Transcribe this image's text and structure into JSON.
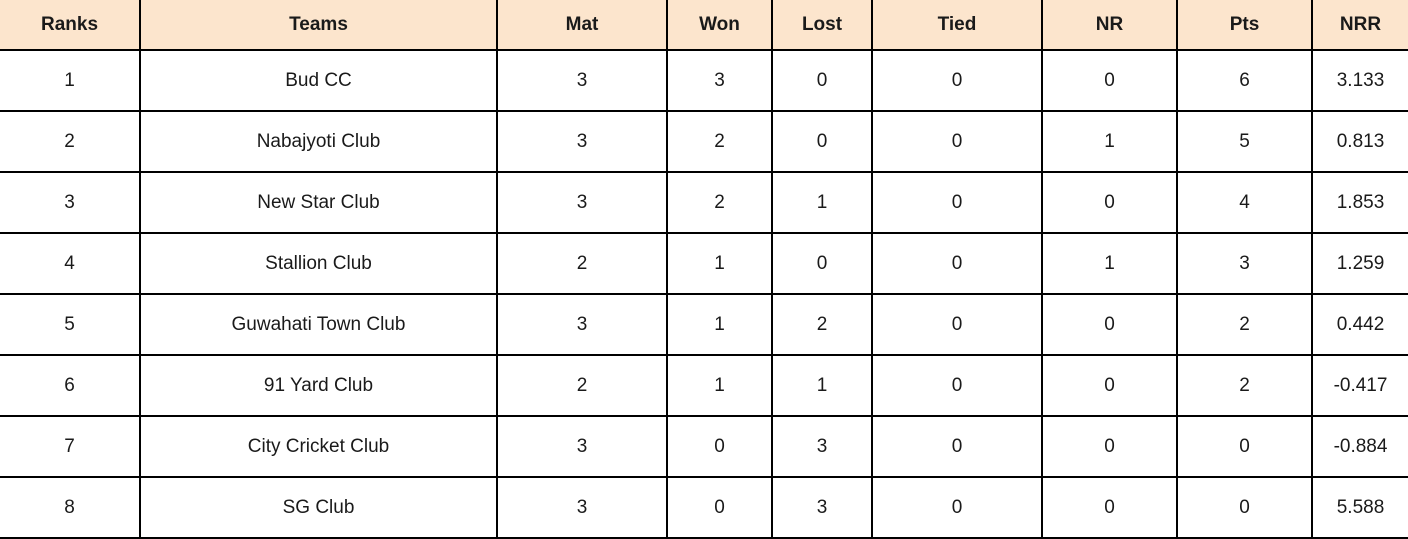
{
  "table": {
    "name": "points-table",
    "header_bg": "#fce5cd",
    "border_color": "#000000",
    "text_color": "#1a1a1a",
    "columns": [
      {
        "key": "rank",
        "label": "Ranks"
      },
      {
        "key": "team",
        "label": "Teams"
      },
      {
        "key": "mat",
        "label": "Mat"
      },
      {
        "key": "won",
        "label": "Won"
      },
      {
        "key": "lost",
        "label": "Lost"
      },
      {
        "key": "tied",
        "label": "Tied"
      },
      {
        "key": "nr",
        "label": "NR"
      },
      {
        "key": "pts",
        "label": "Pts"
      },
      {
        "key": "nrr",
        "label": "NRR"
      }
    ],
    "rows": [
      {
        "rank": "1",
        "team": "Bud CC",
        "mat": "3",
        "won": "3",
        "lost": "0",
        "tied": "0",
        "nr": "0",
        "pts": "6",
        "nrr": "3.133"
      },
      {
        "rank": "2",
        "team": "Nabajyoti Club",
        "mat": "3",
        "won": "2",
        "lost": "0",
        "tied": "0",
        "nr": "1",
        "pts": "5",
        "nrr": "0.813"
      },
      {
        "rank": "3",
        "team": "New Star Club",
        "mat": "3",
        "won": "2",
        "lost": "1",
        "tied": "0",
        "nr": "0",
        "pts": "4",
        "nrr": "1.853"
      },
      {
        "rank": "4",
        "team": "Stallion Club",
        "mat": "2",
        "won": "1",
        "lost": "0",
        "tied": "0",
        "nr": "1",
        "pts": "3",
        "nrr": "1.259"
      },
      {
        "rank": "5",
        "team": "Guwahati Town Club",
        "mat": "3",
        "won": "1",
        "lost": "2",
        "tied": "0",
        "nr": "0",
        "pts": "2",
        "nrr": "0.442"
      },
      {
        "rank": "6",
        "team": "91 Yard Club",
        "mat": "2",
        "won": "1",
        "lost": "1",
        "tied": "0",
        "nr": "0",
        "pts": "2",
        "nrr": "-0.417"
      },
      {
        "rank": "7",
        "team": "City Cricket Club",
        "mat": "3",
        "won": "0",
        "lost": "3",
        "tied": "0",
        "nr": "0",
        "pts": "0",
        "nrr": "-0.884"
      },
      {
        "rank": "8",
        "team": "SG Club",
        "mat": "3",
        "won": "0",
        "lost": "3",
        "tied": "0",
        "nr": "0",
        "pts": "0",
        "nrr": "5.588"
      }
    ]
  }
}
